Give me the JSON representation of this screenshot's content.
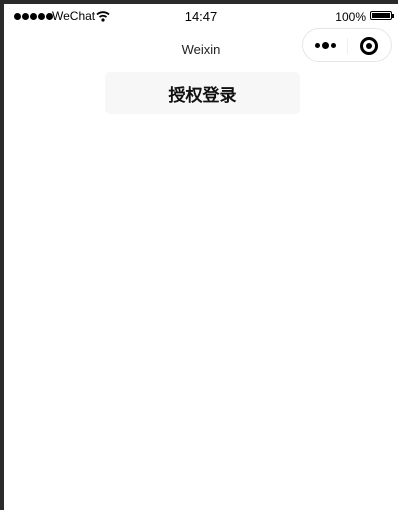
{
  "status_bar": {
    "carrier": "WeChat",
    "time": "14:47",
    "battery_percent": "100%",
    "battery_level": 1.0,
    "icons": [
      "signal-dots-icon",
      "wifi-icon",
      "battery-icon"
    ]
  },
  "nav_bar": {
    "title": "Weixin",
    "capsule_icons": [
      "more-icon",
      "close-miniprogram-icon"
    ]
  },
  "main": {
    "login_button_label": "授权登录"
  },
  "colors": {
    "background": "#ffffff",
    "button_background": "#f7f7f7",
    "frame_border": "#2b2b2b"
  }
}
